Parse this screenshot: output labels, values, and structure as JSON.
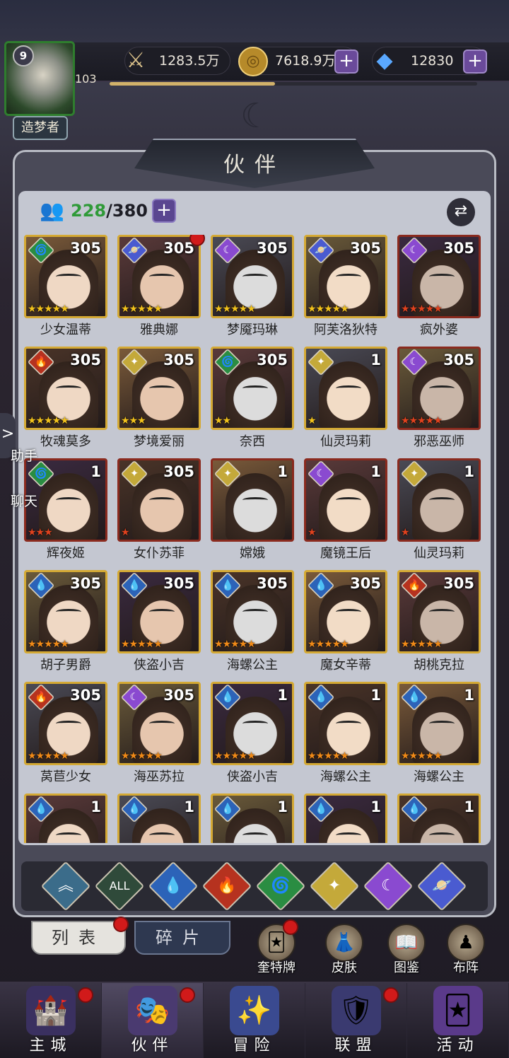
{
  "player": {
    "level": "9",
    "xp_text": "103",
    "xp_progress": 0.45,
    "title": "造梦者"
  },
  "currencies": [
    {
      "name": "power",
      "icon": "sword-icon",
      "value": "1283.5万"
    },
    {
      "name": "gold",
      "icon": "coin-icon",
      "value": "7618.9万"
    },
    {
      "name": "diamond",
      "icon": "diamond-icon",
      "value": "12830"
    }
  ],
  "panel": {
    "title": "伙伴",
    "owned": "228",
    "capacity": "/380"
  },
  "colors": {
    "gold_frame": "#d4a934",
    "red_dot": "#d11a1a",
    "panel_bg": "#c4c7d1",
    "green": "#2f9a38"
  },
  "heroes": [
    {
      "name": "少女温蒂",
      "level": "305",
      "element": "nature",
      "stars": 5,
      "star_color": "gold",
      "badge": false
    },
    {
      "name": "雅典娜",
      "level": "305",
      "element": "void",
      "stars": 5,
      "star_color": "gold",
      "badge": true
    },
    {
      "name": "梦魇玛琳",
      "level": "305",
      "element": "dark",
      "stars": 5,
      "star_color": "gold",
      "badge": false
    },
    {
      "name": "阿芙洛狄特",
      "level": "305",
      "element": "void",
      "stars": 5,
      "star_color": "gold",
      "badge": false
    },
    {
      "name": "疯外婆",
      "level": "305",
      "element": "dark",
      "stars": 5,
      "star_color": "red",
      "badge": false
    },
    {
      "name": "牧魂莫多",
      "level": "305",
      "element": "fire",
      "stars": 5,
      "star_color": "gold",
      "badge": false
    },
    {
      "name": "梦境爱丽",
      "level": "305",
      "element": "light",
      "stars": 3,
      "star_color": "gold",
      "badge": false
    },
    {
      "name": "奈西",
      "level": "305",
      "element": "nature",
      "stars": 2,
      "star_color": "gold",
      "badge": false
    },
    {
      "name": "仙灵玛莉",
      "level": "1",
      "element": "light",
      "stars": 1,
      "star_color": "gold",
      "badge": false
    },
    {
      "name": "邪恶巫师",
      "level": "305",
      "element": "dark",
      "stars": 5,
      "star_color": "red",
      "badge": false
    },
    {
      "name": "辉夜姬",
      "level": "1",
      "element": "nature",
      "stars": 3,
      "star_color": "red",
      "badge": false
    },
    {
      "name": "女仆苏菲",
      "level": "305",
      "element": "light",
      "stars": 1,
      "star_color": "red",
      "badge": false
    },
    {
      "name": "嫦娥",
      "level": "1",
      "element": "light",
      "stars": 0,
      "star_color": "red",
      "badge": false
    },
    {
      "name": "魔镜王后",
      "level": "1",
      "element": "dark",
      "stars": 1,
      "star_color": "red",
      "badge": false
    },
    {
      "name": "仙灵玛莉",
      "level": "1",
      "element": "light",
      "stars": 1,
      "star_color": "red",
      "badge": false
    },
    {
      "name": "胡子男爵",
      "level": "305",
      "element": "water",
      "stars": 5,
      "star_color": "orange",
      "badge": false
    },
    {
      "name": "侠盗小吉",
      "level": "305",
      "element": "water",
      "stars": 5,
      "star_color": "orange",
      "badge": false
    },
    {
      "name": "海螺公主",
      "level": "305",
      "element": "water",
      "stars": 5,
      "star_color": "orange",
      "badge": false
    },
    {
      "name": "魔女辛蒂",
      "level": "305",
      "element": "water",
      "stars": 5,
      "star_color": "orange",
      "badge": false
    },
    {
      "name": "胡桃克拉",
      "level": "305",
      "element": "fire",
      "stars": 5,
      "star_color": "orange",
      "badge": false
    },
    {
      "name": "莴苣少女",
      "level": "305",
      "element": "fire",
      "stars": 5,
      "star_color": "orange",
      "badge": false
    },
    {
      "name": "海巫苏拉",
      "level": "305",
      "element": "dark",
      "stars": 5,
      "star_color": "orange",
      "badge": false
    },
    {
      "name": "侠盗小吉",
      "level": "1",
      "element": "water",
      "stars": 5,
      "star_color": "orange",
      "badge": false
    },
    {
      "name": "海螺公主",
      "level": "1",
      "element": "water",
      "stars": 5,
      "star_color": "orange",
      "badge": false
    },
    {
      "name": "海螺公主",
      "level": "1",
      "element": "water",
      "stars": 5,
      "star_color": "orange",
      "badge": false
    },
    {
      "name": "",
      "level": "1",
      "element": "water",
      "stars": 0,
      "star_color": "orange",
      "badge": false
    },
    {
      "name": "",
      "level": "1",
      "element": "water",
      "stars": 0,
      "star_color": "orange",
      "badge": false
    },
    {
      "name": "",
      "level": "1",
      "element": "water",
      "stars": 0,
      "star_color": "orange",
      "badge": false
    },
    {
      "name": "",
      "level": "1",
      "element": "water",
      "stars": 0,
      "star_color": "orange",
      "badge": false
    },
    {
      "name": "",
      "level": "1",
      "element": "water",
      "stars": 0,
      "star_color": "orange",
      "badge": false
    }
  ],
  "filters": [
    {
      "key": "collapse",
      "label": "︽",
      "color": "#3b6c8a"
    },
    {
      "key": "all",
      "label": "ALL",
      "color": "#2f4a3a"
    },
    {
      "key": "water",
      "label": "💧",
      "color": "#2c63b8"
    },
    {
      "key": "fire",
      "label": "🔥",
      "color": "#b6321f"
    },
    {
      "key": "nature",
      "label": "🌀",
      "color": "#2a8d42"
    },
    {
      "key": "light",
      "label": "✦",
      "color": "#c4a93a"
    },
    {
      "key": "dark",
      "label": "☾",
      "color": "#8a4ad0"
    },
    {
      "key": "void",
      "label": "🪐",
      "color": "#4a5bd0"
    }
  ],
  "tabs": {
    "list": "列表",
    "fragments": "碎片"
  },
  "side_buttons": [
    {
      "label": "奎特牌",
      "icon": "card-deck-icon",
      "badge": true
    },
    {
      "label": "皮肤",
      "icon": "outfit-icon",
      "badge": false
    },
    {
      "label": "图鉴",
      "icon": "book-icon",
      "badge": false
    },
    {
      "label": "布阵",
      "icon": "formation-icon",
      "badge": false
    }
  ],
  "floating": {
    "helper": "助手",
    "chat": "聊天",
    "expand": ">"
  },
  "nav": [
    {
      "label": "主城",
      "icon": "castle-icon",
      "badge": true,
      "active": false
    },
    {
      "label": "伙伴",
      "icon": "partner-icon",
      "badge": true,
      "active": true
    },
    {
      "label": "冒险",
      "icon": "adventure-icon",
      "badge": false,
      "active": false
    },
    {
      "label": "联盟",
      "icon": "alliance-icon",
      "badge": true,
      "active": false
    },
    {
      "label": "活动",
      "icon": "event-icon",
      "badge": false,
      "active": false
    }
  ]
}
